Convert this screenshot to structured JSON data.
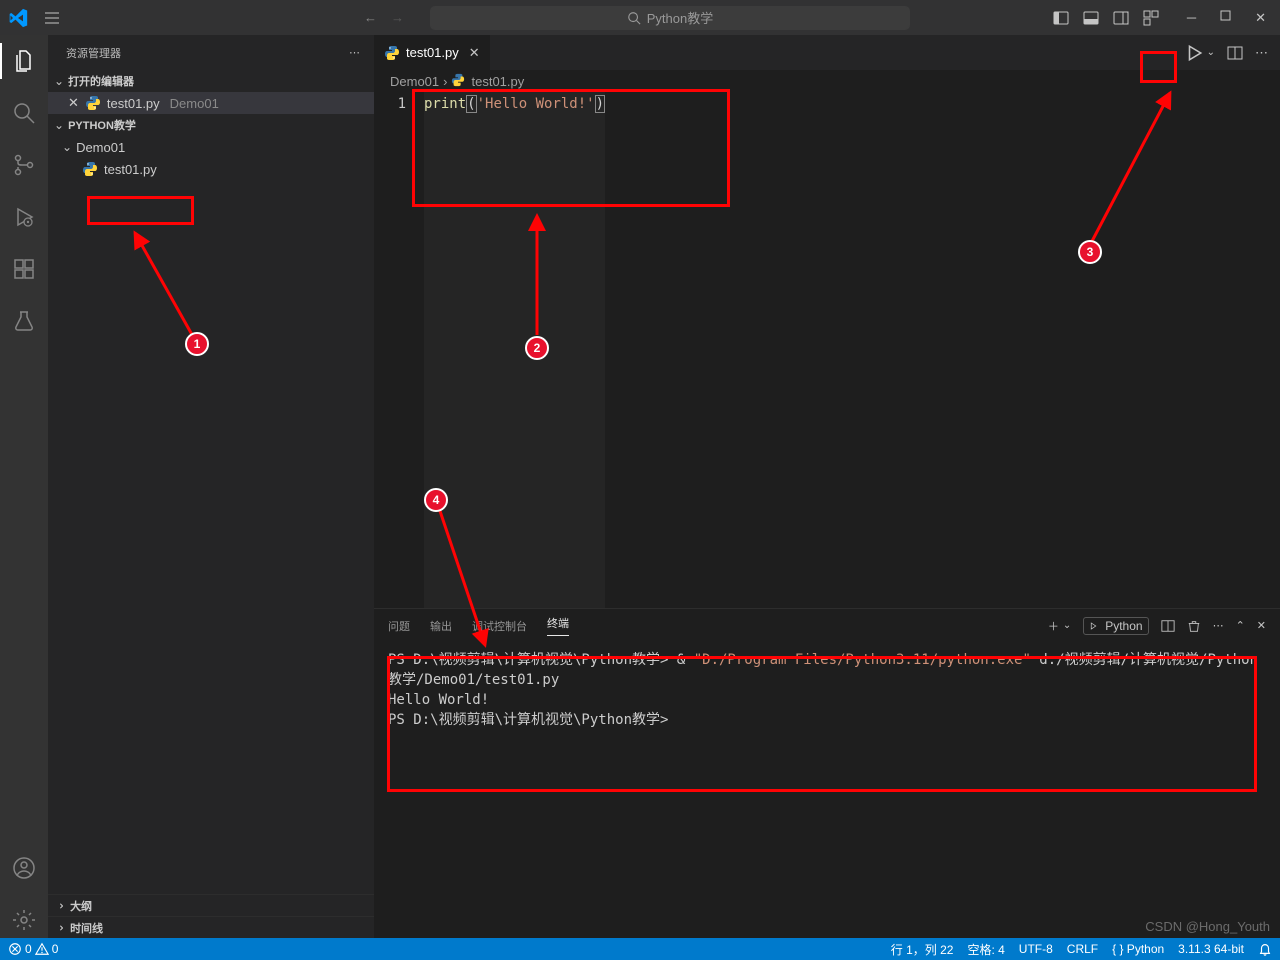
{
  "titlebar": {
    "search_placeholder": "Python教学",
    "nav_back_title": "Back",
    "nav_fwd_title": "Forward"
  },
  "activitybar": {
    "explorer": "Explorer",
    "search": "Search",
    "scm": "Source Control",
    "debug": "Run and Debug",
    "extensions": "Extensions",
    "testing": "Testing",
    "account": "Accounts",
    "settings": "Manage"
  },
  "sidebar": {
    "title": "资源管理器",
    "open_editors": "打开的编辑器",
    "open_file": "test01.py",
    "open_file_hint": "Demo01",
    "workspace": "PYTHON教学",
    "folders": [
      {
        "name": "Demo01",
        "children": [
          "test01.py"
        ]
      }
    ],
    "outline": "大纲",
    "timeline": "时间线"
  },
  "tabs": {
    "active": "test01.py"
  },
  "editor_actions": {
    "run": "Run",
    "split": "Split Editor",
    "more": "More Actions"
  },
  "breadcrumb": {
    "seg1": "Demo01",
    "seg2": "test01.py"
  },
  "code": {
    "line_no": "1",
    "func": "print",
    "open": "(",
    "string": "'Hello World!'",
    "close": ")"
  },
  "panel": {
    "tabs": {
      "problems": "问题",
      "output": "输出",
      "debug": "调试控制台",
      "terminal": "终端"
    },
    "profile": "Python",
    "line1_pre": "PS D:\\视频剪辑\\计算机视觉\\Python教学> & ",
    "line1_exe": "\"D:/Program Files/Python3.11/python.exe\"",
    "line1_post": " d:/视频剪辑/计算机视觉/Python教学/Demo01/test01.py",
    "line2": "Hello World!",
    "line3": "PS D:\\视频剪辑\\计算机视觉\\Python教学>"
  },
  "status": {
    "errors": "0",
    "warnings": "0",
    "line_col": "行 1，列 22",
    "spaces": "空格: 4",
    "encoding": "UTF-8",
    "eol": "CRLF",
    "lang": "{ } Python",
    "interpreter": "3.11.3 64-bit"
  },
  "annotations": {
    "b1": "1",
    "b2": "2",
    "b3": "3",
    "b4": "4"
  },
  "watermark": "CSDN @Hong_Youth"
}
